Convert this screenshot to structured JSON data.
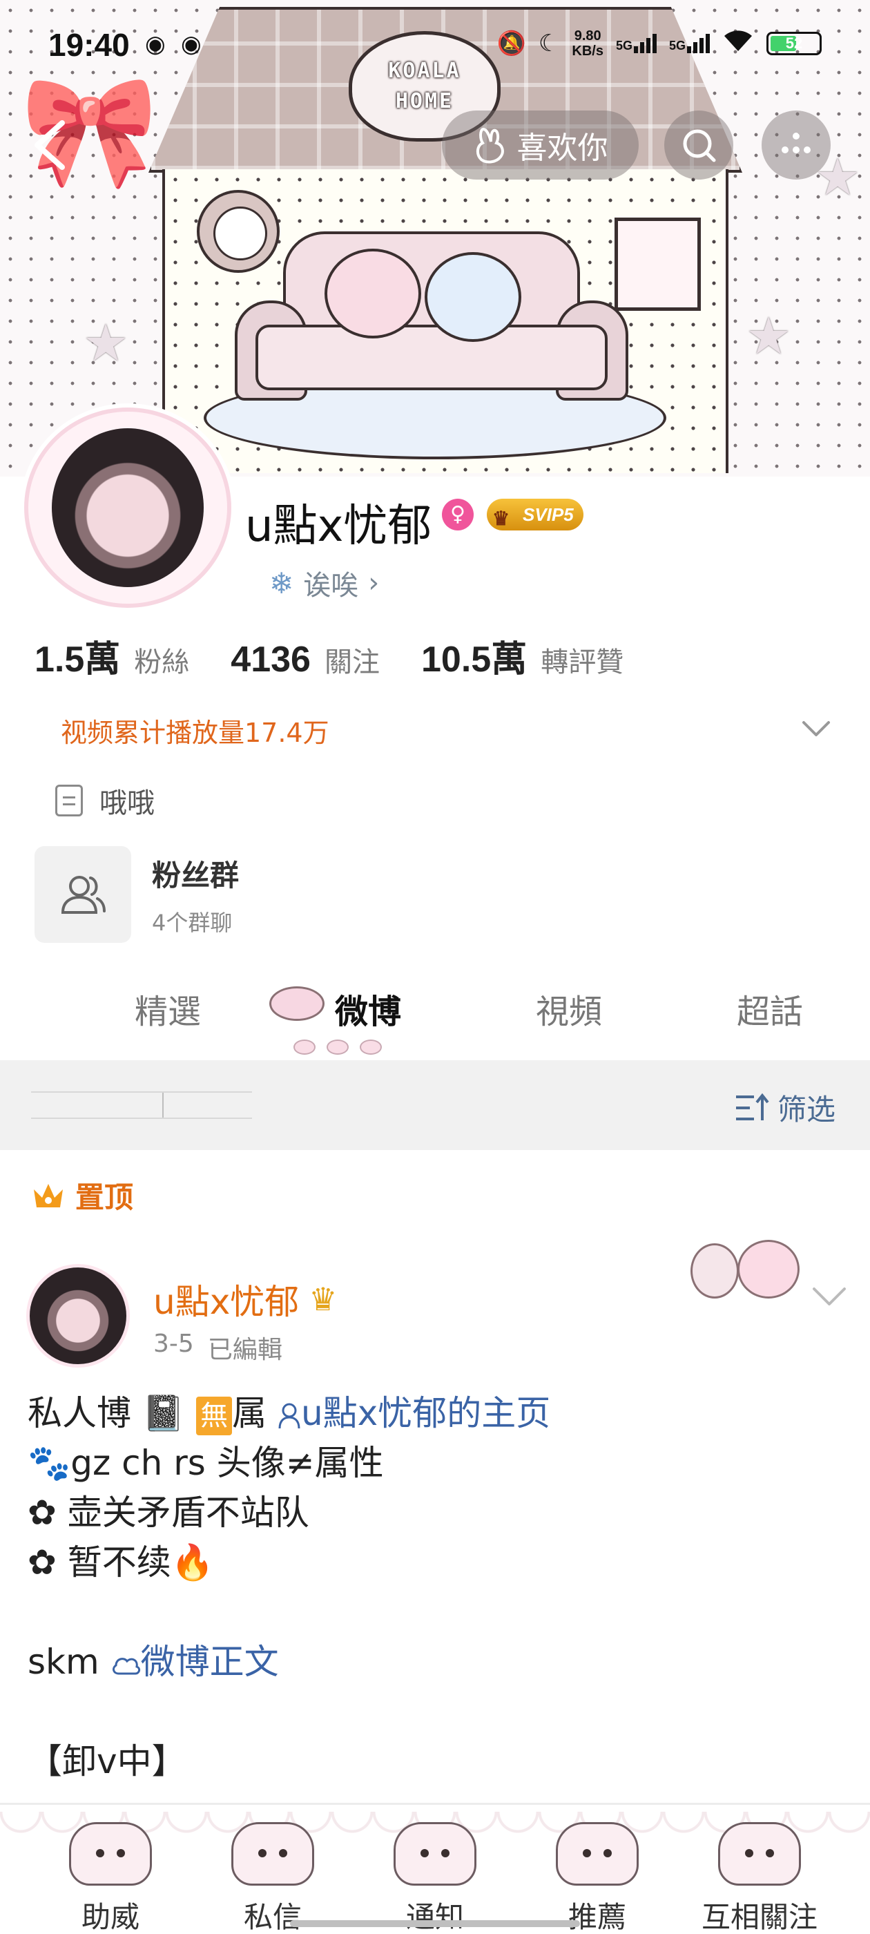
{
  "status_bar": {
    "time": "19:40",
    "net_speed_value": "9.80",
    "net_speed_unit": "KB/s",
    "signal1": "5G",
    "signal2": "5G",
    "battery": "52"
  },
  "cover": {
    "sign_line1": "KOALA",
    "sign_line2": "HOME"
  },
  "top_nav": {
    "like_label": "喜欢你"
  },
  "profile": {
    "username": "u點x忧郁",
    "vip_badge": "SVIP5",
    "bio": "诶唉",
    "stats": [
      {
        "value": "1.5萬",
        "label": "粉絲"
      },
      {
        "value": "4136",
        "label": "關注"
      },
      {
        "value": "10.5萬",
        "label": "轉評贊"
      }
    ],
    "views_text": "视频累计播放量17.4万",
    "description": "哦哦",
    "fan_group": {
      "title": "粉丝群",
      "subtitle": "4个群聊"
    }
  },
  "tabs": [
    {
      "label": "精選",
      "active": false
    },
    {
      "label": "微博",
      "active": true
    },
    {
      "label": "視頻",
      "active": false
    },
    {
      "label": "超話",
      "active": false
    }
  ],
  "filter": {
    "label": "筛选"
  },
  "pinned": {
    "label": "置顶"
  },
  "post": {
    "author": "u點x忧郁",
    "date": "3-5",
    "edited": "已編輯",
    "line1_prefix": "私人博",
    "line1_tag": "無",
    "line1_suffix": "属",
    "line1_link": "u點x忧郁的主页",
    "line2": "🐾gz ch rs 头像≠属性",
    "line3": "✿ 壶关矛盾不站队",
    "line4": "✿ 暂不续🔥",
    "line5_prefix": "skm",
    "line5_link": "微博正文",
    "line6": "【卸v中】"
  },
  "bottom_nav": [
    {
      "label": "助威"
    },
    {
      "label": "私信"
    },
    {
      "label": "通知"
    },
    {
      "label": "推薦"
    },
    {
      "label": "互相關注"
    }
  ],
  "colors": {
    "accent_orange": "#e26d12",
    "link_blue": "#3a63a6",
    "filter_blue": "#4b6b93"
  }
}
